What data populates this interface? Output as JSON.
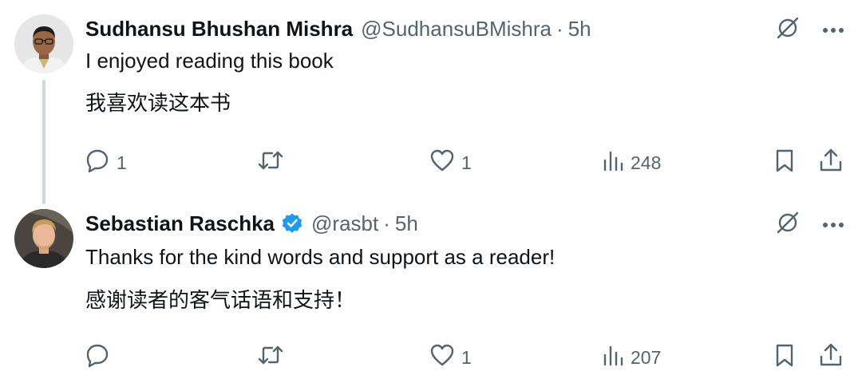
{
  "tweets": [
    {
      "author": "Sudhansu Bhushan Mishra",
      "handle": "@SudhansuBMishra",
      "separator": "·",
      "time": "5h",
      "verified": false,
      "lines": [
        "I enjoyed reading this book",
        "我喜欢读这本书"
      ],
      "replies": "1",
      "reposts": "",
      "likes": "1",
      "views": "248",
      "icons": [
        "grok-icon",
        "more-icon",
        "reply-icon",
        "repost-icon",
        "like-icon",
        "views-icon",
        "bookmark-icon",
        "share-icon"
      ]
    },
    {
      "author": "Sebastian Raschka",
      "handle": "@rasbt",
      "separator": "·",
      "time": "5h",
      "verified": true,
      "lines": [
        "Thanks for the kind words and support as a reader!",
        "感谢读者的客气话语和支持！"
      ],
      "replies": "",
      "reposts": "",
      "likes": "1",
      "views": "207",
      "icons": [
        "grok-icon",
        "more-icon",
        "reply-icon",
        "repost-icon",
        "like-icon",
        "views-icon",
        "bookmark-icon",
        "share-icon"
      ]
    }
  ],
  "colors": {
    "text": "#0f1419",
    "secondary": "#536471",
    "thread_line": "#cfd9de",
    "verified": "#1d9bf0"
  }
}
